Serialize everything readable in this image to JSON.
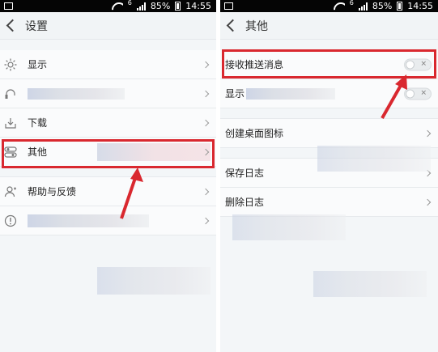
{
  "status_bar": {
    "battery": "85%",
    "time": "14:55",
    "network": "6"
  },
  "left": {
    "title": "设置",
    "items": [
      {
        "label": "显示",
        "icon": "sun-icon"
      },
      {
        "label": "",
        "icon": "headset-icon",
        "blurred": true
      },
      {
        "label": "下载",
        "icon": "download-icon"
      },
      {
        "label": "其他",
        "icon": "toggles-icon"
      },
      {
        "label": "帮助与反馈",
        "icon": "person-icon"
      },
      {
        "label": "",
        "icon": "info-icon",
        "blurred": true
      }
    ]
  },
  "right": {
    "title": "其他",
    "items": [
      {
        "label": "接收推送消息",
        "toggle": "off"
      },
      {
        "label": "显示",
        "toggle": "off",
        "partially_blurred": true
      },
      {
        "label": "创建桌面图标"
      },
      {
        "label": "保存日志"
      },
      {
        "label": "删除日志"
      }
    ]
  },
  "colors": {
    "highlight": "#d9282f",
    "background": "#f3f6f8",
    "statusbar": "#050505"
  }
}
